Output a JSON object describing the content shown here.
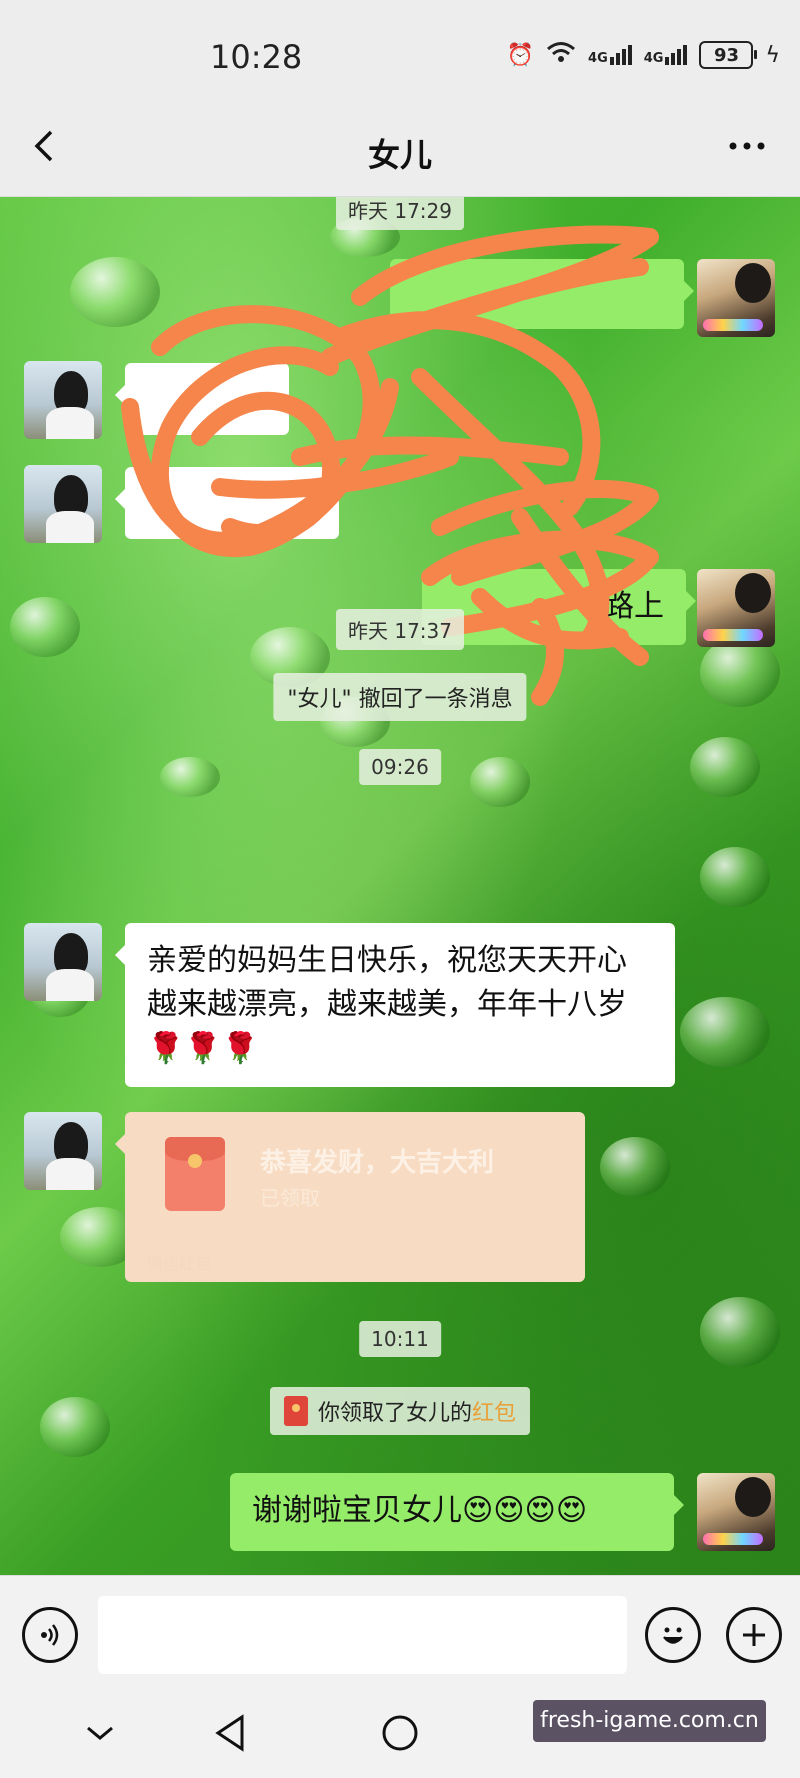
{
  "status_bar": {
    "time": "10:28",
    "network_1": "4G",
    "network_2": "4G",
    "battery": "93"
  },
  "header": {
    "title": "女儿"
  },
  "messages": {
    "ts_1": "昨天 17:29",
    "right_1_visible": "路上",
    "ts_2": "昨天 17:37",
    "recall_notice": "\"女儿\" 撤回了一条消息",
    "ts_3": "09:26",
    "birthday_message": "亲爱的妈妈生日快乐，祝您天天开心越来越漂亮，越来越美，年年十八岁🌹🌹🌹",
    "red_packet": {
      "title": "恭喜发财，大吉大利",
      "status": "已领取",
      "footer": "微信红包"
    },
    "ts_4": "10:11",
    "received_notice": "你领取了女儿的",
    "received_notice_link": "红包",
    "thanks_message": "谢谢啦宝贝女儿😍😍😍😍"
  },
  "watermark": "fresh-igame.com.cn",
  "colors": {
    "bubble_right": "#95ec69",
    "bubble_left": "#ffffff",
    "red_packet": "#f7dcc3",
    "scribble": "#f5854a"
  }
}
